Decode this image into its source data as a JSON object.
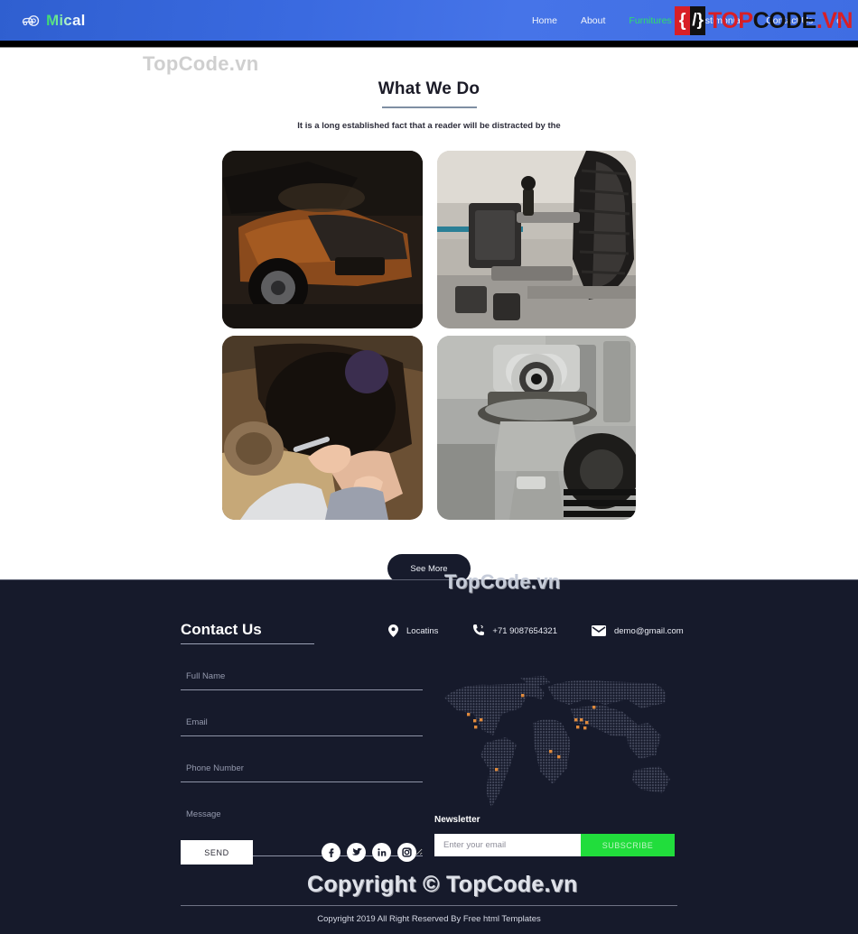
{
  "header": {
    "brand": {
      "name": "Mical",
      "icon": "car-gear-icon"
    },
    "nav": [
      {
        "label": "Home",
        "active": false
      },
      {
        "label": "About",
        "active": false
      },
      {
        "label": "Furnitures",
        "active": true
      },
      {
        "label": "Testimonial",
        "active": false
      },
      {
        "label": "Contact Us",
        "active": false
      }
    ],
    "mail_icon_label": "e",
    "accent_active": "#2ee06a",
    "background": "#3a6ae0"
  },
  "watermark_logo": {
    "brace_left": "{",
    "brace_right": "/}",
    "top": "TOP",
    "code": "CODE",
    "vn": ".VN",
    "red": "#d81f26",
    "black": "#111111"
  },
  "watermarks": {
    "top": "TopCode.vn",
    "middle": "TopCode.vn",
    "bottom": "Copyright © TopCode.vn"
  },
  "section": {
    "title": "What We Do",
    "subtitle": "It is a long established fact that a reader will be distracted by the",
    "see_more": "See More"
  },
  "gallery": [
    {
      "name": "classic-car-open-hood",
      "alt": "Brown classic car with hood open showing engine"
    },
    {
      "name": "wheel-alignment-machine",
      "alt": "Wheel alignment equipment attached to car tire"
    },
    {
      "name": "mechanic-under-car",
      "alt": "Mechanic working under a vehicle wheel arch"
    },
    {
      "name": "engine-gear-closeup",
      "alt": "Close up of metal engine gears and housing"
    }
  ],
  "contact": {
    "title": "Contact Us",
    "items": [
      {
        "icon": "location-pin-icon",
        "text": "Locatins"
      },
      {
        "icon": "phone-icon",
        "text": "+71 9087654321"
      },
      {
        "icon": "envelope-icon",
        "text": "demo@gmail.com"
      }
    ],
    "form": {
      "full_name_placeholder": "Full Name",
      "email_placeholder": "Email",
      "phone_placeholder": "Phone Number",
      "message_placeholder": "Message",
      "send_label": "SEND",
      "values": {
        "full_name": "",
        "email": "",
        "phone": "",
        "message": ""
      }
    },
    "socials": [
      {
        "icon": "facebook-icon",
        "label": "Facebook"
      },
      {
        "icon": "twitter-icon",
        "label": "Twitter"
      },
      {
        "icon": "linkedin-icon",
        "label": "LinkedIn"
      },
      {
        "icon": "instagram-icon",
        "label": "Instagram"
      }
    ]
  },
  "newsletter": {
    "label": "Newsletter",
    "placeholder": "Enter your email",
    "value": "",
    "button": "SUBSCRIBE",
    "button_color": "#21dd3c"
  },
  "footer": {
    "copyright": "Copyright 2019 All Right Reserved By Free html Templates"
  },
  "map": {
    "name": "world-dot-map",
    "marker_color": "#e08a3c",
    "dot_color": "#4a4f63"
  }
}
